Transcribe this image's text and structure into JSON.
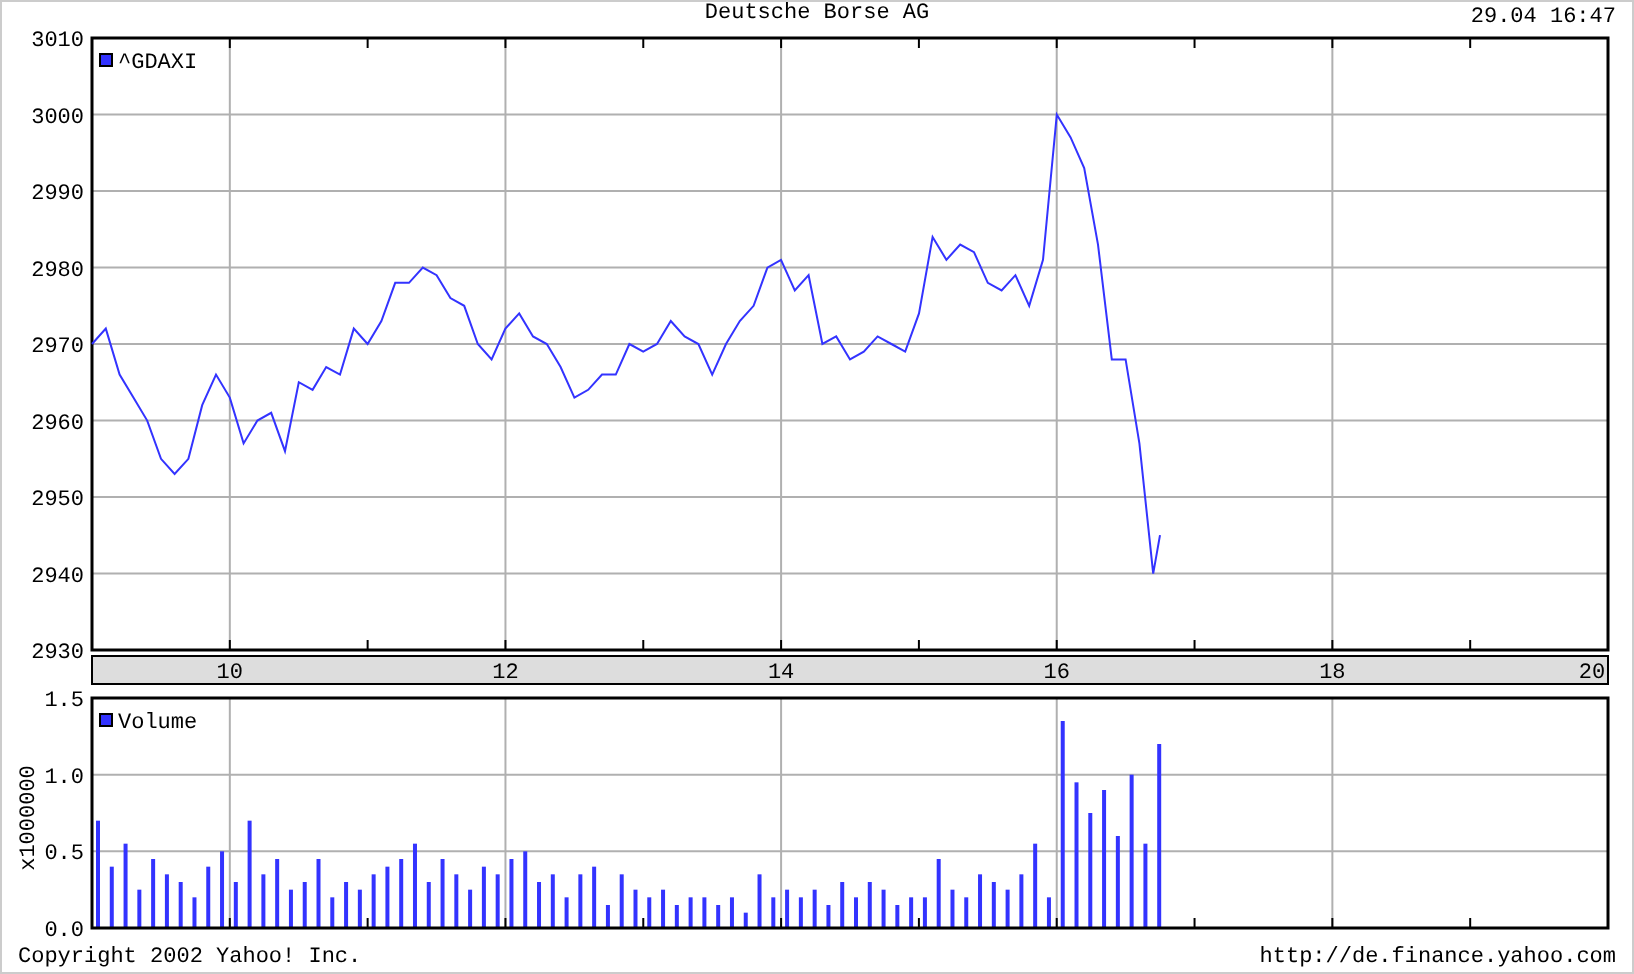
{
  "header": {
    "title": "Deutsche Borse AG",
    "timestamp": "29.04 16:47"
  },
  "price_chart": {
    "chart_data": {
      "type": "line",
      "grid": true,
      "xlim": [
        9,
        20
      ],
      "ylim": [
        2930,
        3010
      ],
      "xticks": [
        10,
        12,
        14,
        16,
        18,
        20
      ],
      "yticks": [
        2930,
        2940,
        2950,
        2960,
        2970,
        2980,
        2990,
        3000,
        3010
      ],
      "x": [
        9.0,
        9.1,
        9.2,
        9.3,
        9.4,
        9.5,
        9.6,
        9.7,
        9.8,
        9.9,
        10.0,
        10.1,
        10.2,
        10.3,
        10.4,
        10.5,
        10.6,
        10.7,
        10.8,
        10.9,
        11.0,
        11.1,
        11.2,
        11.3,
        11.4,
        11.5,
        11.6,
        11.7,
        11.8,
        11.9,
        12.0,
        12.1,
        12.2,
        12.3,
        12.4,
        12.5,
        12.6,
        12.7,
        12.8,
        12.9,
        13.0,
        13.1,
        13.2,
        13.3,
        13.4,
        13.5,
        13.6,
        13.7,
        13.8,
        13.9,
        14.0,
        14.1,
        14.2,
        14.3,
        14.4,
        14.5,
        14.6,
        14.7,
        14.8,
        14.9,
        15.0,
        15.1,
        15.2,
        15.3,
        15.4,
        15.5,
        15.6,
        15.7,
        15.8,
        15.9,
        16.0,
        16.1,
        16.2,
        16.3,
        16.4,
        16.5,
        16.6,
        16.7,
        16.75
      ],
      "series": [
        {
          "name": "^GDAXI",
          "color": "#3333ff",
          "values": [
            2970,
            2972,
            2966,
            2963,
            2960,
            2955,
            2953,
            2955,
            2962,
            2966,
            2963,
            2957,
            2960,
            2961,
            2956,
            2965,
            2964,
            2967,
            2966,
            2972,
            2970,
            2973,
            2978,
            2978,
            2980,
            2979,
            2976,
            2975,
            2970,
            2968,
            2972,
            2974,
            2971,
            2970,
            2967,
            2963,
            2964,
            2966,
            2966,
            2970,
            2969,
            2970,
            2973,
            2971,
            2970,
            2966,
            2970,
            2973,
            2975,
            2980,
            2981,
            2977,
            2979,
            2970,
            2971,
            2968,
            2969,
            2971,
            2970,
            2969,
            2974,
            2984,
            2981,
            2983,
            2982,
            2978,
            2977,
            2979,
            2975,
            2981,
            3000,
            2997,
            2993,
            2983,
            2968,
            2968,
            2957,
            2940,
            2945
          ]
        }
      ]
    }
  },
  "volume_chart": {
    "chart_data": {
      "type": "bar",
      "grid": true,
      "ylabel": "x1000000",
      "xlim": [
        9,
        20
      ],
      "ylim": [
        0,
        1.5
      ],
      "yticks": [
        {
          "value": 0,
          "label": "0.0"
        },
        {
          "value": 0.5,
          "label": "0.5"
        },
        {
          "value": 1,
          "label": "1.0"
        },
        {
          "value": 1.5,
          "label": "1.5"
        }
      ],
      "x": [
        9.0,
        9.1,
        9.2,
        9.3,
        9.4,
        9.5,
        9.6,
        9.7,
        9.8,
        9.9,
        10.0,
        10.1,
        10.2,
        10.3,
        10.4,
        10.5,
        10.6,
        10.7,
        10.8,
        10.9,
        11.0,
        11.1,
        11.2,
        11.3,
        11.4,
        11.5,
        11.6,
        11.7,
        11.8,
        11.9,
        12.0,
        12.1,
        12.2,
        12.3,
        12.4,
        12.5,
        12.6,
        12.7,
        12.8,
        12.9,
        13.0,
        13.1,
        13.2,
        13.3,
        13.4,
        13.5,
        13.6,
        13.7,
        13.8,
        13.9,
        14.0,
        14.1,
        14.2,
        14.3,
        14.4,
        14.5,
        14.6,
        14.7,
        14.8,
        14.9,
        15.0,
        15.1,
        15.2,
        15.3,
        15.4,
        15.5,
        15.6,
        15.7,
        15.8,
        15.9,
        16.0,
        16.1,
        16.2,
        16.3,
        16.4,
        16.5,
        16.6,
        16.7
      ],
      "series": [
        {
          "name": "Volume",
          "color": "#3333ff",
          "values": [
            0.7,
            0.4,
            0.55,
            0.25,
            0.45,
            0.35,
            0.3,
            0.2,
            0.4,
            0.5,
            0.3,
            0.7,
            0.35,
            0.45,
            0.25,
            0.3,
            0.45,
            0.2,
            0.3,
            0.25,
            0.35,
            0.4,
            0.45,
            0.55,
            0.3,
            0.45,
            0.35,
            0.25,
            0.4,
            0.35,
            0.45,
            0.5,
            0.3,
            0.35,
            0.2,
            0.35,
            0.4,
            0.15,
            0.35,
            0.25,
            0.2,
            0.25,
            0.15,
            0.2,
            0.2,
            0.15,
            0.2,
            0.1,
            0.35,
            0.2,
            0.25,
            0.2,
            0.25,
            0.15,
            0.3,
            0.2,
            0.3,
            0.25,
            0.15,
            0.2,
            0.2,
            0.45,
            0.25,
            0.2,
            0.35,
            0.3,
            0.25,
            0.35,
            0.55,
            0.2,
            1.35,
            0.95,
            0.75,
            0.9,
            0.6,
            1.0,
            0.55,
            1.2
          ]
        }
      ]
    }
  },
  "footer": {
    "copyright": "Copyright 2002 Yahoo! Inc.",
    "url": "http://de.finance.yahoo.com"
  }
}
